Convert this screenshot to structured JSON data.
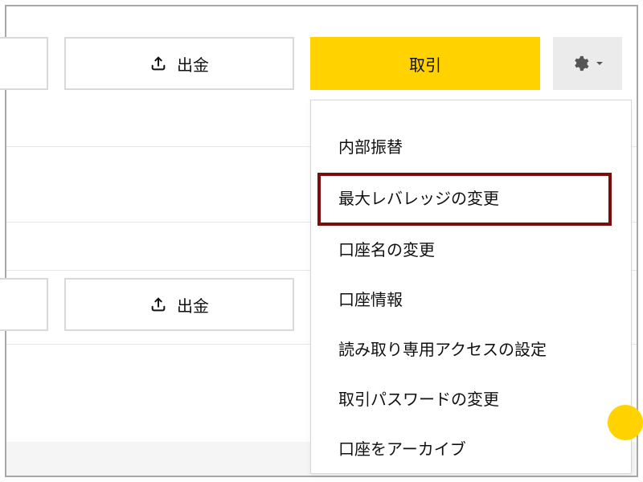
{
  "toolbar": {
    "withdraw_label": "出金",
    "trade_label": "取引"
  },
  "dropdown": {
    "items": [
      {
        "label": "内部振替"
      },
      {
        "label": "最大レバレッジの変更",
        "highlighted": true
      },
      {
        "label": "口座名の変更"
      },
      {
        "label": "口座情報"
      },
      {
        "label": "読み取り専用アクセスの設定"
      },
      {
        "label": "取引パスワードの変更"
      },
      {
        "label": "口座をアーカイブ"
      }
    ]
  },
  "colors": {
    "accent": "#ffd200",
    "highlight_border": "#7a0c0c"
  }
}
